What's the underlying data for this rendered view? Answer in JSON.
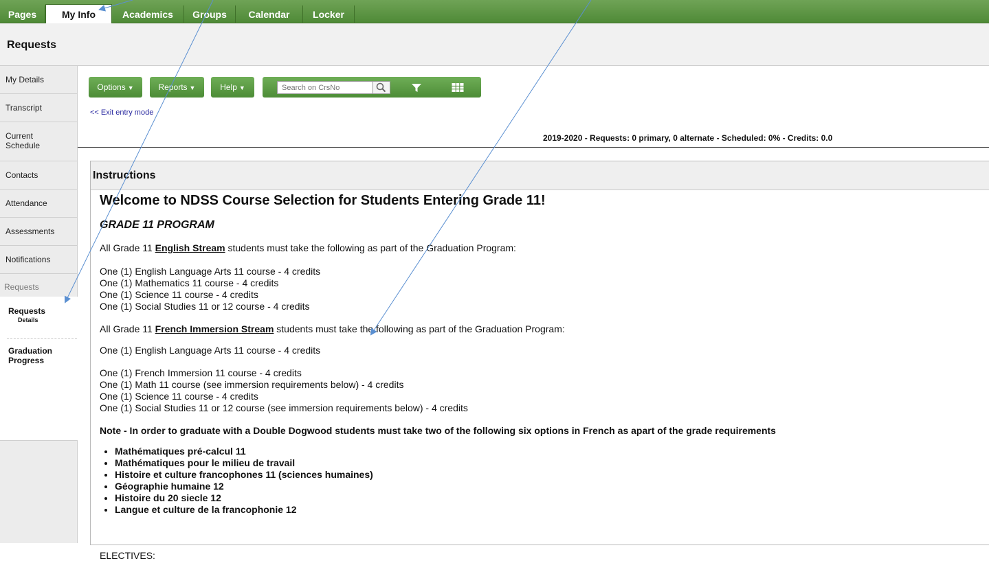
{
  "tabs": [
    {
      "label": "Pages",
      "active": false
    },
    {
      "label": "My Info",
      "active": true
    },
    {
      "label": "Academics",
      "active": false
    },
    {
      "label": "Groups",
      "active": false
    },
    {
      "label": "Calendar",
      "active": false
    },
    {
      "label": "Locker",
      "active": false
    }
  ],
  "header": {
    "title": "Requests"
  },
  "sidebar": {
    "items": [
      "My Details",
      "Transcript",
      "Current Schedule",
      "Contacts",
      "Attendance",
      "Assessments",
      "Notifications"
    ],
    "section_label": "Requests",
    "sub_items": [
      {
        "label": "Requests",
        "sublabel": "Details"
      },
      {
        "label": "Graduation Progress"
      }
    ]
  },
  "toolbar": {
    "options_label": "Options",
    "reports_label": "Reports",
    "help_label": "Help",
    "search_placeholder": "Search on CrsNo"
  },
  "exit_link": "<< Exit entry mode",
  "summary": "2019-2020 - Requests: 0 primary, 0 alternate - Scheduled: 0% - Credits: 0.0",
  "instructions": {
    "heading": "Instructions",
    "welcome": "Welcome to NDSS Course Selection for Students Entering Grade 11!",
    "program": "GRADE 11 PROGRAM",
    "english_intro_pre": "All Grade 11 ",
    "english_stream": "English Stream",
    "intro_post": " students must take the following as part of the Graduation Program:",
    "english_courses": [
      "One (1) English Language Arts 11 course - 4 credits",
      "One (1) Mathematics 11 course - 4 credits",
      "One (1) Science 11 course - 4 credits",
      "One (1) Social Studies 11 or 12 course - 4 credits"
    ],
    "french_stream": "French Immersion Stream",
    "french_first": "One (1) English Language Arts 11 course - 4 credits",
    "french_courses": [
      "One (1) French Immersion 11 course - 4 credits",
      "One (1) Math 11 course (see immersion requirements below) - 4 credits",
      "One (1) Science 11 course - 4 credits",
      "One (1) Social Studies 11 or 12 course (see immersion requirements below) - 4 credits"
    ],
    "note": "Note - In order to graduate with a Double Dogwood students must take two of the following six options in French as apart of the grade requirements",
    "french_options": [
      "Mathématiques pré-calcul 11",
      "Mathématiques pour le milieu de travail",
      "Histoire et culture francophones 11 (sciences humaines)",
      "Géographie humaine 12",
      "Histoire du 20 siecle 12",
      "Langue et culture de la francophonie 12"
    ],
    "electives": "ELECTIVES:"
  },
  "colors": {
    "green": "#5a9a3f",
    "arrow": "#5a8fd1",
    "link": "#2a2aa0"
  }
}
